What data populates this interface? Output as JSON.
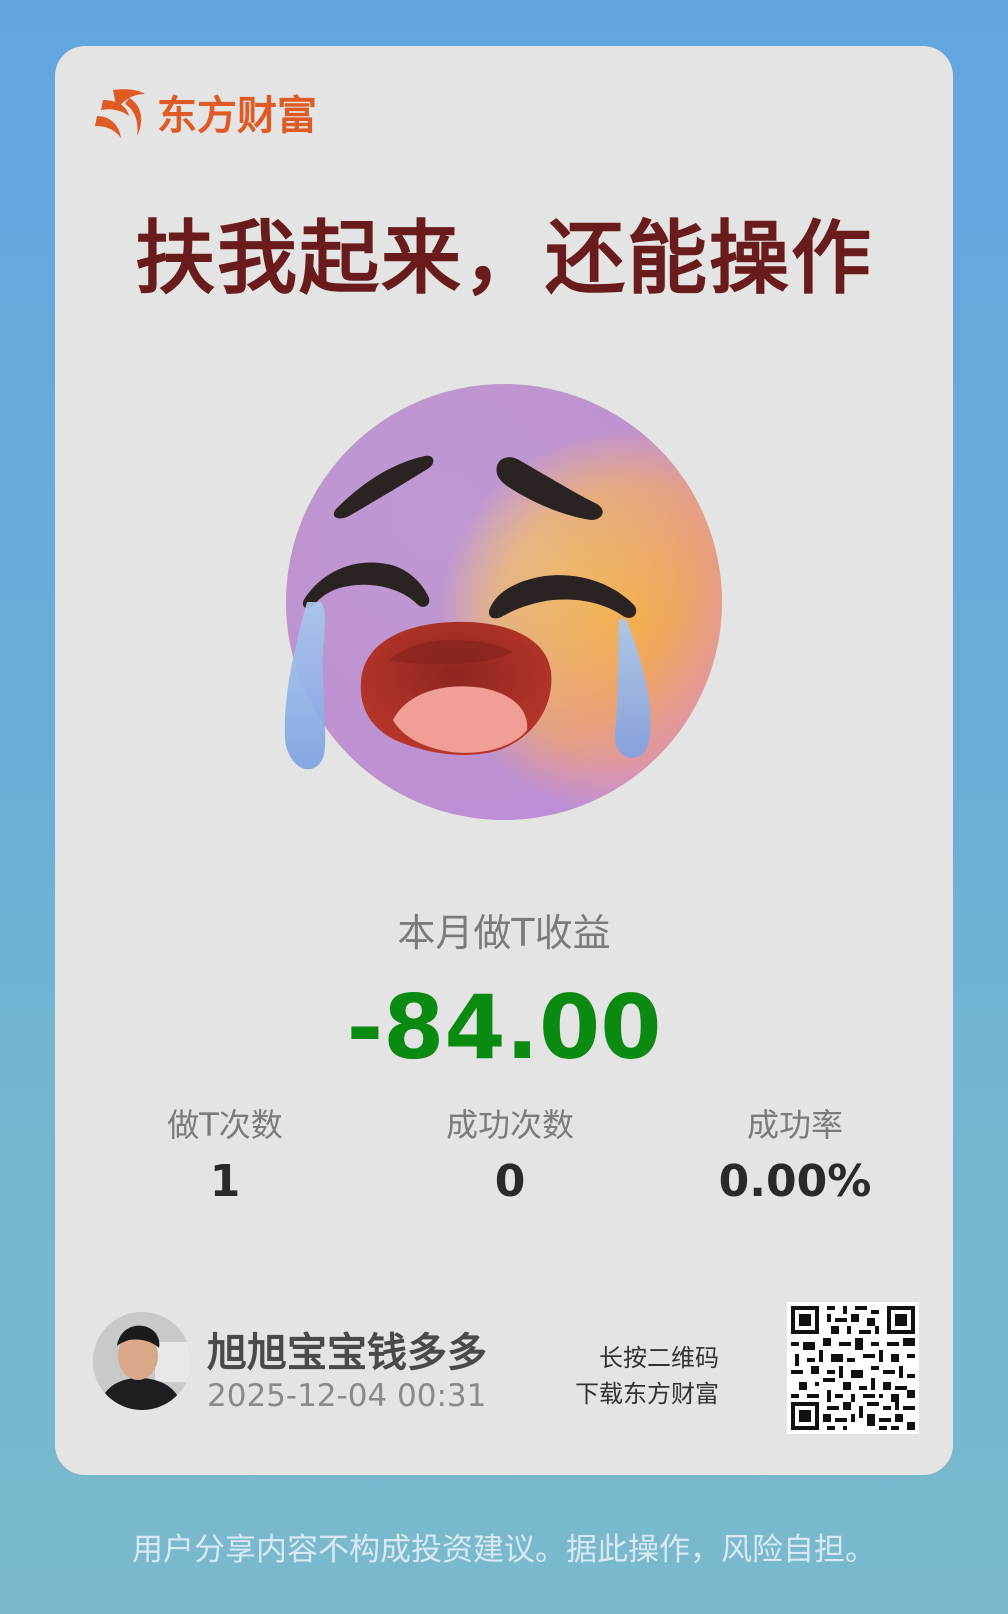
{
  "brand": {
    "name": "东方财富",
    "color": "#e05a24"
  },
  "headline": "扶我起来，还能操作",
  "emoji": {
    "icon": "crying-face-emoji"
  },
  "summary": {
    "label": "本月做T收益",
    "value": "-84.00",
    "value_color": "#0b8a12"
  },
  "metrics": [
    {
      "label": "做T次数",
      "value": "1"
    },
    {
      "label": "成功次数",
      "value": "0"
    },
    {
      "label": "成功率",
      "value": "0.00%"
    }
  ],
  "user": {
    "name": "旭旭宝宝钱多多",
    "timestamp": "2025-12-04 00:31"
  },
  "qr_prompt": {
    "line1": "长按二维码",
    "line2": "下载东方财富"
  },
  "disclaimer": "用户分享内容不构成投资建议。据此操作，风险自担。"
}
